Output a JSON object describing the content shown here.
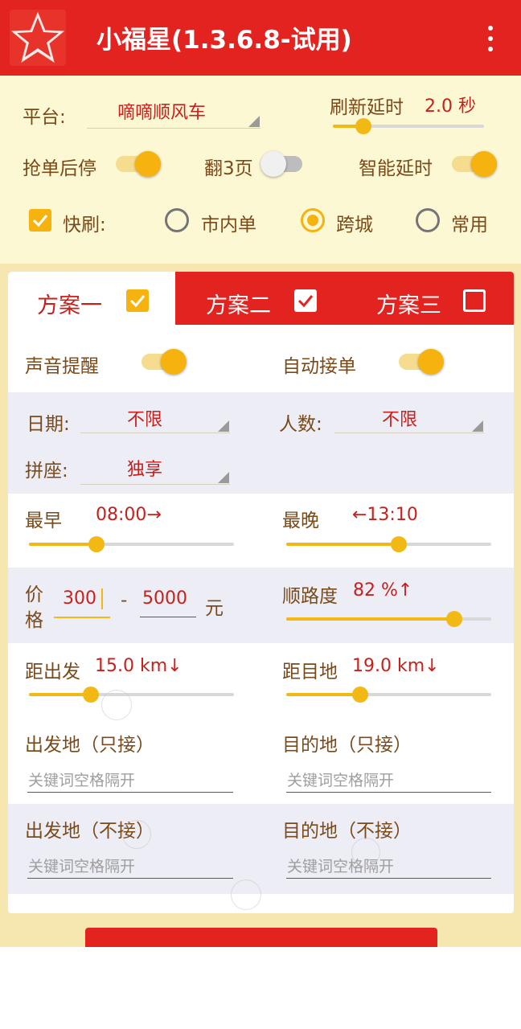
{
  "app": {
    "title": "小福星(1.3.6.8-试用)",
    "logo_text": "小福星"
  },
  "settings": {
    "platform_label": "平台:",
    "platform_value": "嘀嘀顺风车",
    "refresh_label": "刷新延时",
    "refresh_value": "2.0 秒",
    "refresh_level": 0.2,
    "stop_after_grab_label": "抢单后停",
    "stop_after_grab_on": true,
    "flip_pages_label": "翻3页",
    "flip_pages_on": false,
    "smart_delay_label": "智能延时",
    "smart_delay_on": true,
    "fast_refresh_label": "快刷:",
    "fast_refresh_checked": true,
    "radio_options": [
      "市内单",
      "跨城",
      "常用"
    ],
    "radio_selected": "跨城"
  },
  "tabs": [
    {
      "label": "方案一",
      "checked": true,
      "active": true
    },
    {
      "label": "方案二",
      "checked": true,
      "active": false
    },
    {
      "label": "方案三",
      "checked": false,
      "active": false
    }
  ],
  "plan": {
    "sound_alert_label": "声音提醒",
    "sound_alert_on": true,
    "auto_accept_label": "自动接单",
    "auto_accept_on": true,
    "date_label": "日期:",
    "date_value": "不限",
    "people_label": "人数:",
    "people_value": "不限",
    "carpool_label": "拼座:",
    "carpool_value": "独享",
    "earliest_label": "最早",
    "earliest_value": "08:00→",
    "earliest_level": 0.33,
    "latest_label": "最晚",
    "latest_value": "←13:10",
    "latest_level": 0.55,
    "price_label_line1": "价",
    "price_label_line2": "格",
    "price_min": "300",
    "price_dash": "-",
    "price_max": "5000",
    "price_unit": "元",
    "route_label": "顺路度",
    "route_value": "82 %↑",
    "route_level": 0.82,
    "dist_start_label": "距出发",
    "dist_start_value": "15.0 km↓",
    "dist_start_level": 0.3,
    "dist_dest_label": "距目地",
    "dist_dest_value": "19.0 km↓",
    "dist_dest_level": 0.36,
    "from_only_label": "出发地（只接）",
    "from_only_placeholder": "关键词空格隔开",
    "to_only_label": "目的地（只接）",
    "to_only_placeholder": "关键词空格隔开",
    "from_exclude_label": "出发地（不接）",
    "from_exclude_placeholder": "关键词空格隔开",
    "to_exclude_label": "目的地（不接）",
    "to_exclude_placeholder": "关键词空格隔开"
  },
  "colors": {
    "primary_red": "#e22320",
    "accent_yellow": "#f6b20f",
    "label_brown": "#7a4a1b",
    "value_red": "#c8201c",
    "panel_cream": "#fdf8d4"
  }
}
